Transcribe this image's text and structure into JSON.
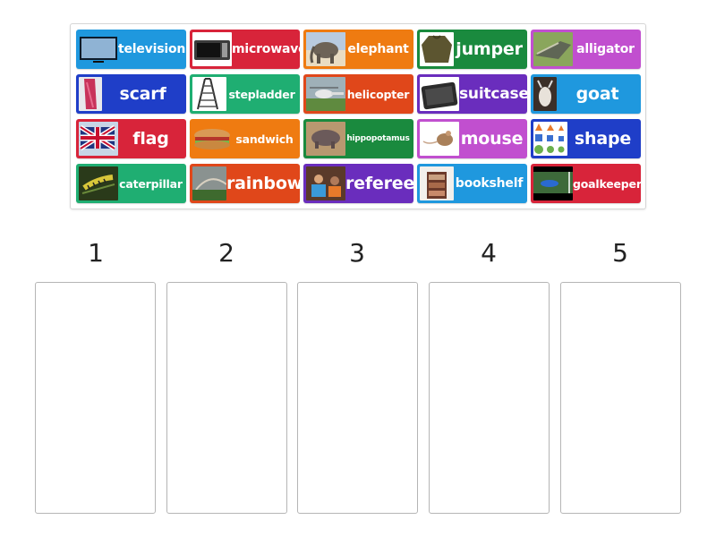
{
  "tiles": [
    {
      "label": "television",
      "icon": "television-icon",
      "color": "#1f98de"
    },
    {
      "label": "microwave",
      "icon": "microwave-icon",
      "color": "#d8243a"
    },
    {
      "label": "elephant",
      "icon": "elephant-icon",
      "color": "#ef7b11"
    },
    {
      "label": "jumper",
      "icon": "jumper-icon",
      "color": "#1a8a3e"
    },
    {
      "label": "alligator",
      "icon": "alligator-icon",
      "color": "#c14fcf"
    },
    {
      "label": "scarf",
      "icon": "scarf-icon",
      "color": "#1f3ec8"
    },
    {
      "label": "stepladder",
      "icon": "stepladder-icon",
      "color": "#1fae72"
    },
    {
      "label": "helicopter",
      "icon": "helicopter-icon",
      "color": "#e0471a"
    },
    {
      "label": "suitcase",
      "icon": "suitcase-icon",
      "color": "#6a2dbd"
    },
    {
      "label": "goat",
      "icon": "goat-icon",
      "color": "#1f98de"
    },
    {
      "label": "flag",
      "icon": "flag-icon",
      "color": "#d8243a"
    },
    {
      "label": "sandwich",
      "icon": "sandwich-icon",
      "color": "#ef7b11"
    },
    {
      "label": "hippopotamus",
      "icon": "hippopotamus-icon",
      "color": "#1a8a3e"
    },
    {
      "label": "mouse",
      "icon": "mouse-icon",
      "color": "#c14fcf"
    },
    {
      "label": "shape",
      "icon": "shapes-icon",
      "color": "#1f3ec8"
    },
    {
      "label": "caterpillar",
      "icon": "caterpillar-icon",
      "color": "#1fae72"
    },
    {
      "label": "rainbow",
      "icon": "rainbow-icon",
      "color": "#e0471a"
    },
    {
      "label": "referee",
      "icon": "referee-icon",
      "color": "#6a2dbd"
    },
    {
      "label": "bookshelf",
      "icon": "bookshelf-icon",
      "color": "#1f98de"
    },
    {
      "label": "goalkeeper",
      "icon": "goalkeeper-icon",
      "color": "#d8243a"
    }
  ],
  "columns": [
    {
      "number": "1"
    },
    {
      "number": "2"
    },
    {
      "number": "3"
    },
    {
      "number": "4"
    },
    {
      "number": "5"
    }
  ]
}
